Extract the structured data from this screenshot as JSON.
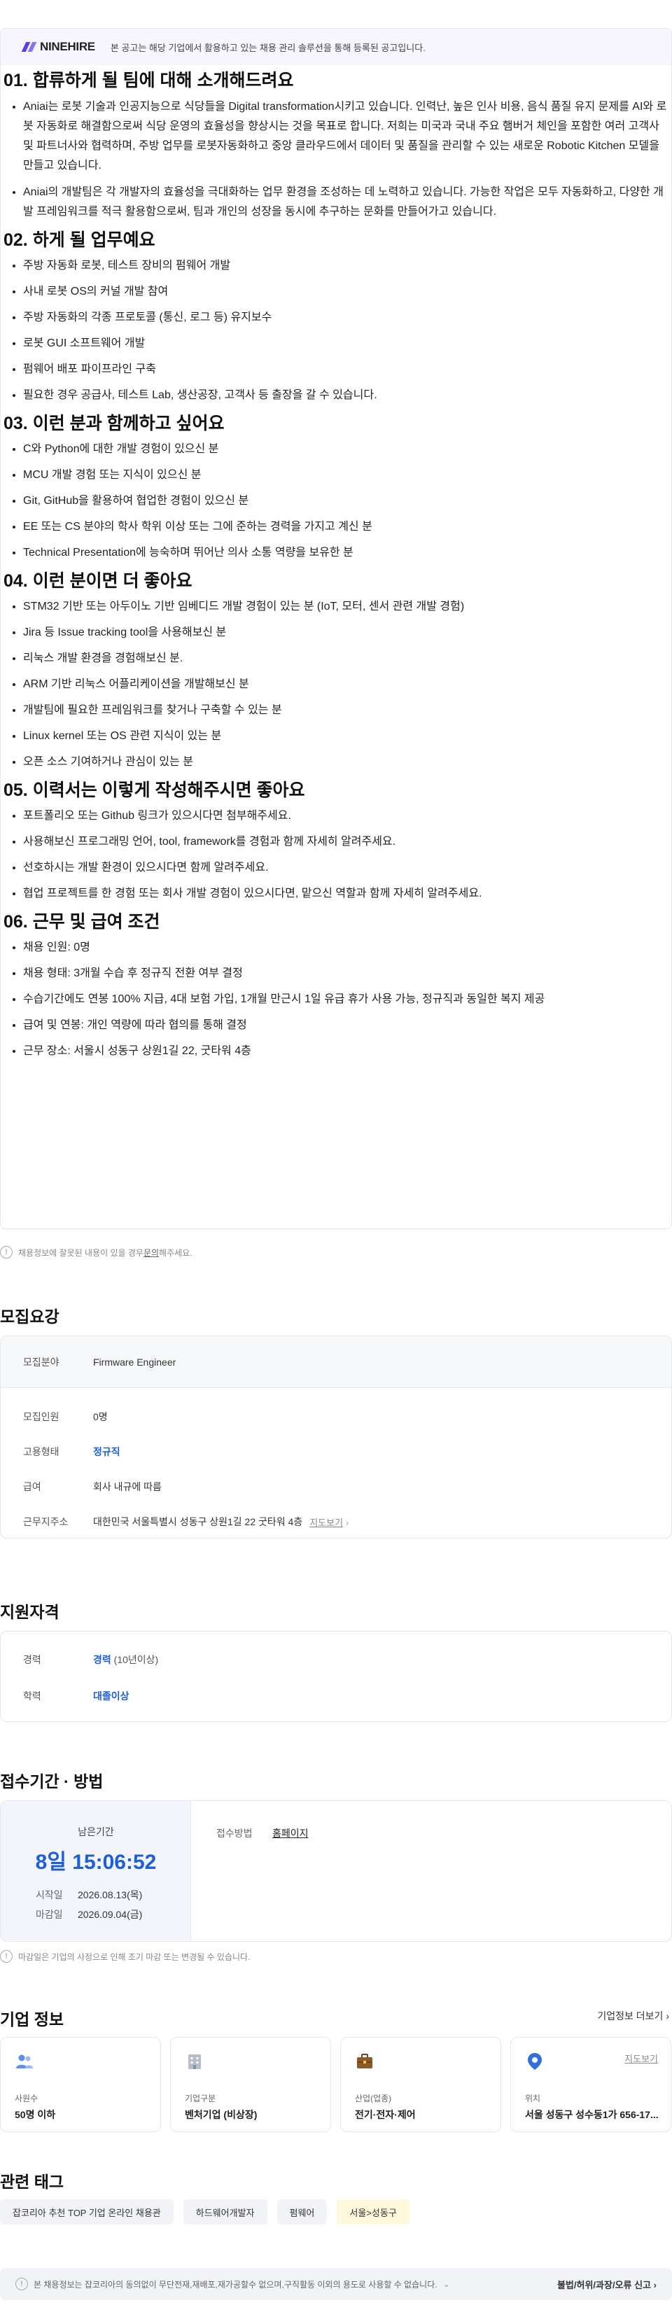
{
  "banner": {
    "logo": "NINEHIRE",
    "text": "본 공고는 해당 기업에서 활용하고 있는 채용 관리 솔루션을 통해 등록된 공고입니다."
  },
  "jd": {
    "s1": {
      "title": "01. 합류하게 될 팀에 대해 소개해드려요",
      "p1": "Aniai는 로봇 기술과 인공지능으로 식당들을 Digital transformation시키고 있습니다. 인력난, 높은 인사 비용, 음식 품질 유지 문제를 AI와 로봇 자동화로 해결함으로써 식당 운영의 효율성을 향상시는 것을 목표로 합니다. 저희는 미국과 국내 주요 햄버거 체인을 포함한 여러 고객사 및 파트너사와 협력하며, 주방 업무를 로봇자동화하고 중앙 클라우드에서 데이터 및 품질을 관리할 수 있는 새로운 Robotic Kitchen 모델을 만들고 있습니다.",
      "p2": "Aniai의 개발팀은 각 개발자의 효율성을 극대화하는 업무 환경을 조성하는 데 노력하고 있습니다. 가능한 작업은 모두 자동화하고, 다양한 개발 프레임워크를 적극 활용함으로써, 팀과 개인의 성장을 동시에 추구하는 문화를 만들어가고 있습니다."
    },
    "s2": {
      "title": "02. 하게 될 업무예요",
      "items": [
        "주방 자동화 로봇, 테스트 장비의 펌웨어 개발",
        "사내 로봇 OS의 커널 개발 참여",
        "주방 자동화의 각종 프로토콜 (통신, 로그 등) 유지보수",
        "로봇 GUI 소프트웨어 개발",
        "펌웨어 배포 파이프라인 구축",
        "필요한 경우 공급사, 테스트 Lab, 생산공장, 고객사 등 출장을 갈 수 있습니다."
      ]
    },
    "s3": {
      "title": "03. 이런 분과 함께하고 싶어요",
      "items": [
        "C와 Python에 대한 개발 경험이 있으신 분",
        "MCU 개발 경험 또는 지식이 있으신 분",
        "Git, GitHub을 활용하여 협업한 경험이 있으신 분",
        "EE 또는 CS 분야의 학사 학위 이상 또는 그에 준하는 경력을 가지고 계신 분",
        "Technical Presentation에 능숙하며 뛰어난 의사 소통 역량을 보유한 분"
      ]
    },
    "s4": {
      "title": "04. 이런 분이면 더 좋아요",
      "items": [
        "STM32 기반 또는 아두이노 기반 임베디드 개발 경험이 있는 분 (IoT, 모터, 센서 관련 개발 경험)",
        "Jira 등 Issue tracking tool을 사용해보신 분",
        "리눅스 개발 환경을 경험해보신 분.",
        "ARM 기반 리눅스 어플리케이션을 개발해보신 분",
        "개발팀에 필요한 프레임워크를 찾거나 구축할 수 있는 분",
        "Linux kernel 또는 OS 관련 지식이 있는 분",
        "오픈 소스 기여하거나 관심이 있는 분"
      ]
    },
    "s5": {
      "title": "05. 이력서는 이렇게 작성해주시면 좋아요",
      "items": [
        "포트폴리오 또는 Github 링크가 있으시다면 첨부해주세요.",
        "사용해보신 프로그래밍 언어, tool, framework를 경험과 함께 자세히 알려주세요.",
        "선호하시는 개발 환경이 있으시다면 함께 알려주세요.",
        "협업 프로젝트를 한 경험 또는 회사 개발 경험이 있으시다면, 맡으신 역할과 함께 자세히 알려주세요."
      ]
    },
    "s6": {
      "title": "06. 근무 및 급여 조건",
      "items": [
        "채용 인원: 0명",
        "채용 형태: 3개월 수습 후 정규직 전환 여부 결정",
        "수습기간에도 연봉 100% 지급, 4대 보험 가입, 1개월 만근시 1일 유급 휴가 사용 가능, 정규직과 동일한 복지 제공",
        "급여 및 연봉: 개인 역량에 따라 협의를 통해 결정",
        "근무 장소: 서울시 성동구 상원1길 22, 굿타워 4층"
      ]
    }
  },
  "report": {
    "text_before": "채용정보에 잘못된 내용이 있을 경우 ",
    "link": "문의",
    "text_after": "해주세요."
  },
  "recruit": {
    "title": "모집요강",
    "field_label": "모집분야",
    "field_value": "Firmware Engineer",
    "count_label": "모집인원",
    "count_value": "0명",
    "type_label": "고용형태",
    "type_value": "정규직",
    "salary_label": "급여",
    "salary_value": "회사 내규에 따름",
    "address_label": "근무지주소",
    "address_value": "대한민국 서울특별시 성동구 상원1길 22 굿타워 4층",
    "map_link": "지도보기"
  },
  "qualify": {
    "title": "지원자격",
    "career_label": "경력",
    "career_value": "경력",
    "career_sub": " (10년이상)",
    "edu_label": "학력",
    "edu_value": "대졸이상"
  },
  "period": {
    "title": "접수기간 · 방법",
    "remain_label": "남은기간",
    "remain_value": "8일 15:06:52",
    "start_label": "시작일",
    "start_value": "2026.08.13(목)",
    "end_label": "마감일",
    "end_value": "2026.09.04(금)",
    "method_label": "접수방법",
    "method_value": "홈페이지",
    "notice": "마감일은 기업의 사정으로 인해 조기 마감 또는 변경될 수 있습니다."
  },
  "company": {
    "title": "기업 정보",
    "more": "기업정보 더보기",
    "cards": [
      {
        "label": "사원수",
        "value": "50명 이하"
      },
      {
        "label": "기업구분",
        "value": "벤처기업 (비상장)"
      },
      {
        "label": "산업(업종)",
        "value": "전기·전자·제어"
      },
      {
        "label": "위치",
        "value": "서울 성동구 성수동1가 656-17...",
        "map": "지도보기"
      }
    ],
    "colors": {
      "people": "#5b8def",
      "building": "#9aa3b1",
      "briefcase": "#8a5a2b",
      "pin": "#2f6fe0"
    }
  },
  "tags": {
    "title": "관련 태그",
    "items": [
      "잡코리아 추천 TOP 기업 온라인 채용관",
      "하드웨어개발자",
      "펌웨어",
      "서울>성동구"
    ]
  },
  "footer": {
    "text": "본 채용정보는 잡코리아의 동의없이 무단전재,재배포,재가공할수 없으며,구직활동 이외의 용도로 사용할 수 없습니다.",
    "right": "불법/허위/과장/오류 신고"
  }
}
